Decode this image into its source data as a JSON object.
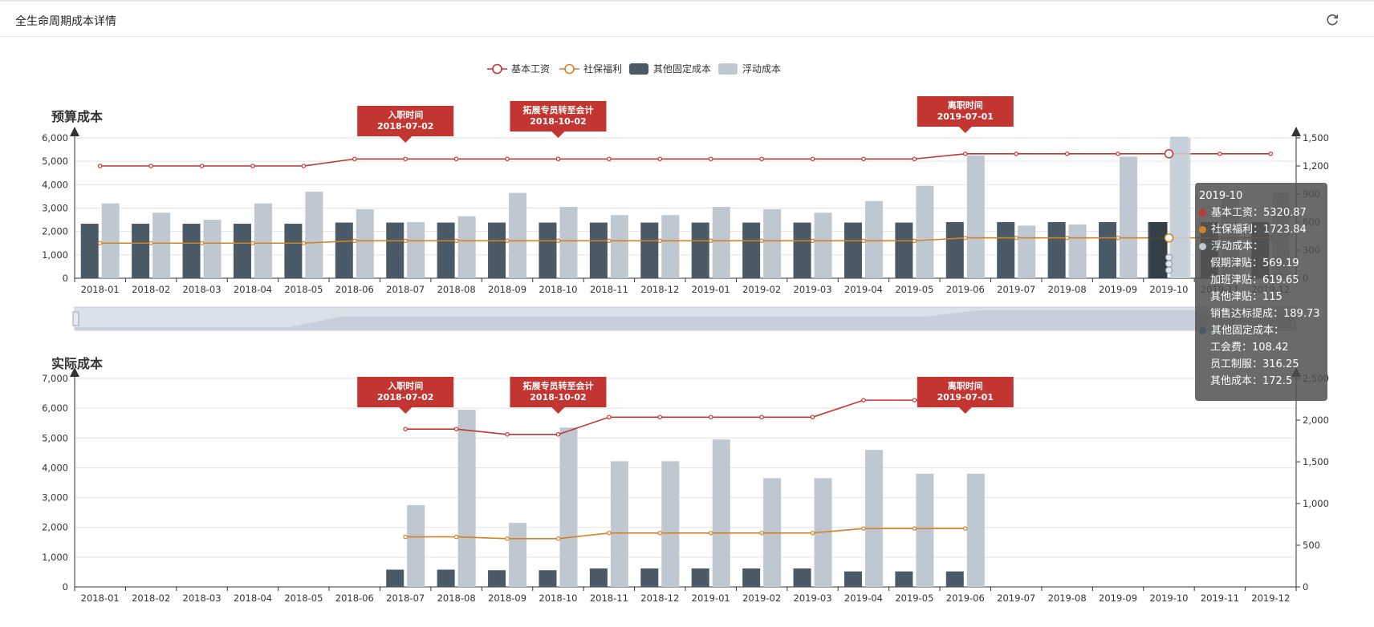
{
  "header": {
    "title": "全生命周期成本详情",
    "refresh_icon": "refresh-icon"
  },
  "colors": {
    "salary": "#c23531",
    "social": "#d48226",
    "fixed": "#4a5a66",
    "floating": "#bfc7d1",
    "markpoint": "#c23531"
  },
  "legend": [
    "基本工资",
    "社保福利",
    "其他固定成本",
    "浮动成本"
  ],
  "chart_data": [
    {
      "type": "bar",
      "title": "预算成本",
      "categories": [
        "2018-01",
        "2018-02",
        "2018-03",
        "2018-04",
        "2018-05",
        "2018-06",
        "2018-07",
        "2018-08",
        "2018-09",
        "2018-10",
        "2018-11",
        "2018-12",
        "2019-01",
        "2019-02",
        "2019-03",
        "2019-04",
        "2019-05",
        "2019-06",
        "2019-07",
        "2019-08",
        "2019-09",
        "2019-10",
        "2019-11",
        "2019-12"
      ],
      "ylim": [
        0,
        6000
      ],
      "yticks": [
        "0",
        "1,000",
        "2,000",
        "3,000",
        "4,000",
        "5,000",
        "6,000"
      ],
      "y2lim": [
        0,
        1500
      ],
      "y2ticks": [
        "0",
        "300",
        "600",
        "900",
        "1,200",
        "1,500"
      ],
      "series": [
        {
          "name": "基本工资",
          "type": "line",
          "values": [
            4800,
            4800,
            4800,
            4800,
            4800,
            5100,
            5100,
            5100,
            5100,
            5100,
            5100,
            5100,
            5100,
            5100,
            5100,
            5100,
            5100,
            5320.87,
            5320.87,
            5320.87,
            5320.87,
            5320.87,
            5320.87,
            5320.87
          ]
        },
        {
          "name": "社保福利",
          "type": "line",
          "values": [
            1500,
            1500,
            1500,
            1500,
            1500,
            1600,
            1600,
            1600,
            1600,
            1600,
            1600,
            1600,
            1600,
            1600,
            1600,
            1600,
            1600,
            1723.84,
            1723.84,
            1723.84,
            1723.84,
            1723.84,
            1723.84,
            1723.84
          ]
        },
        {
          "name": "其他固定成本",
          "type": "bar",
          "values": [
            2330,
            2330,
            2330,
            2330,
            2330,
            2380,
            2380,
            2380,
            2380,
            2380,
            2380,
            2380,
            2380,
            2380,
            2380,
            2380,
            2380,
            2400,
            2400,
            2400,
            2400,
            2400,
            2400,
            2400
          ]
        },
        {
          "name": "浮动成本",
          "type": "bar",
          "values": [
            3200,
            2800,
            2500,
            3200,
            3700,
            2950,
            2400,
            2650,
            3650,
            3050,
            2700,
            2700,
            3050,
            2950,
            2800,
            3300,
            3950,
            5250,
            2250,
            2300,
            5200,
            6050,
            3500,
            3650
          ]
        }
      ],
      "annotations": [
        {
          "category": "2018-07",
          "label": "入职时间",
          "date": "2018-07-02"
        },
        {
          "category": "2018-10",
          "label": "拓展专员转至会计",
          "date": "2018-10-02"
        },
        {
          "category": "2019-06",
          "label": "离职时间",
          "date": "2019-07-01"
        }
      ]
    },
    {
      "type": "bar",
      "title": "实际成本",
      "categories": [
        "2018-01",
        "2018-02",
        "2018-03",
        "2018-04",
        "2018-05",
        "2018-06",
        "2018-07",
        "2018-08",
        "2018-09",
        "2018-10",
        "2018-11",
        "2018-12",
        "2019-01",
        "2019-02",
        "2019-03",
        "2019-04",
        "2019-05",
        "2019-06",
        "2019-07",
        "2019-08",
        "2019-09",
        "2019-10",
        "2019-11",
        "2019-12"
      ],
      "ylim": [
        0,
        7000
      ],
      "yticks": [
        "0",
        "1,000",
        "2,000",
        "3,000",
        "4,000",
        "5,000",
        "6,000",
        "7,000"
      ],
      "y2lim": [
        0,
        2500
      ],
      "y2ticks": [
        "0",
        "500",
        "1,000",
        "1,500",
        "2,000",
        "2,500"
      ],
      "series": [
        {
          "name": "基本工资",
          "type": "line",
          "values": [
            null,
            null,
            null,
            null,
            null,
            null,
            5300,
            5300,
            5120,
            5120,
            5700,
            5700,
            5700,
            5700,
            5700,
            6270,
            6270,
            6270,
            null,
            null,
            null,
            null,
            null,
            null
          ]
        },
        {
          "name": "社保福利",
          "type": "line",
          "values": [
            null,
            null,
            null,
            null,
            null,
            null,
            1680,
            1680,
            1620,
            1620,
            1810,
            1810,
            1810,
            1810,
            1810,
            1960,
            1960,
            1960,
            null,
            null,
            null,
            null,
            null,
            null
          ]
        },
        {
          "name": "其他固定成本",
          "type": "bar",
          "values": [
            null,
            null,
            null,
            null,
            null,
            null,
            580,
            580,
            560,
            560,
            620,
            620,
            620,
            620,
            620,
            520,
            520,
            520,
            null,
            null,
            null,
            null,
            null,
            null
          ]
        },
        {
          "name": "浮动成本",
          "type": "bar",
          "values": [
            null,
            null,
            null,
            null,
            null,
            null,
            2750,
            5950,
            2150,
            5350,
            4220,
            4220,
            4950,
            3650,
            3650,
            4600,
            3800,
            3800,
            null,
            null,
            null,
            null,
            null,
            null
          ]
        }
      ],
      "annotations": [
        {
          "category": "2018-07",
          "label": "入职时间",
          "date": "2018-07-02"
        },
        {
          "category": "2018-10",
          "label": "拓展专员转至会计",
          "date": "2018-10-02"
        },
        {
          "category": "2019-06",
          "label": "离职时间",
          "date": "2019-07-01"
        }
      ]
    }
  ],
  "tooltip": {
    "title": "2019-10",
    "rows": [
      {
        "label": "基本工资：5320.87",
        "color": "#c23531"
      },
      {
        "label": "社保福利：1723.84",
        "color": "#d48226"
      },
      {
        "label": "浮动成本：",
        "color": "#bfc7d1"
      }
    ],
    "floating_items": [
      "假期津贴：569.19",
      "加班津贴：619.65",
      "其他津贴：115",
      "销售达标提成：189.73"
    ],
    "fixed_header": {
      "label": "其他固定成本：",
      "color": "#4a5a66"
    },
    "fixed_items": [
      "工会费：108.42",
      "员工制服：316.25",
      "其他成本：172.5"
    ]
  }
}
